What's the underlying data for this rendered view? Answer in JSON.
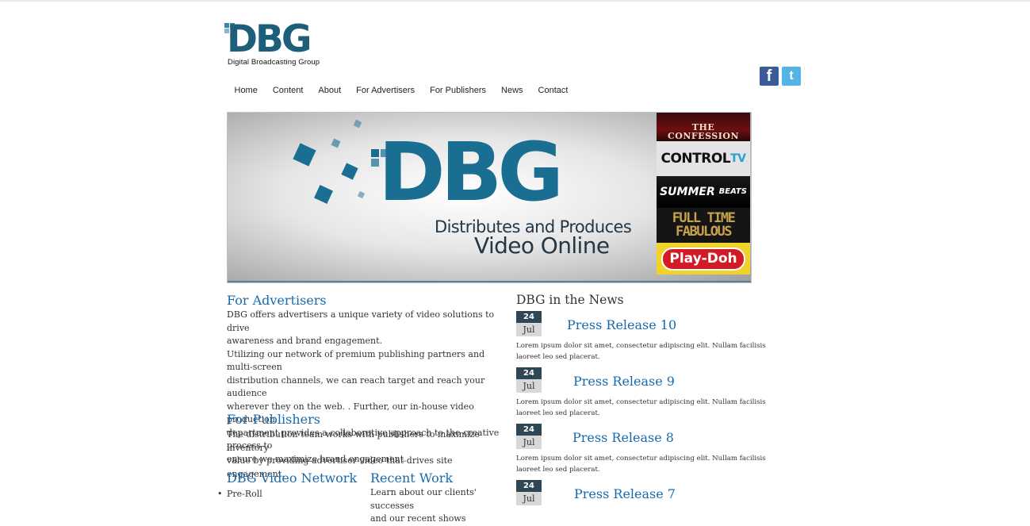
{
  "brand": {
    "logo_text": "DBG",
    "logo_subtitle": "Digital Broadcasting Group",
    "brand_color": "#1d5f7a"
  },
  "social": {
    "facebook_icon": "facebook-icon",
    "twitter_icon": "twitter-icon"
  },
  "nav": {
    "items": [
      "Home",
      "Content",
      "About",
      "For Advertisers",
      "For Publishers",
      "News",
      "Contact"
    ]
  },
  "hero": {
    "logo_text": "DBG",
    "line1": "Distributes and Produces",
    "line2": "Video Online",
    "tiles": [
      "THE CONFESSION",
      "CONTROL",
      "TV",
      "SUMMER",
      "BEATS",
      "FULL TIME\nFABULOUS",
      "Play-Doh"
    ]
  },
  "advertisers": {
    "heading": "For Advertisers",
    "lines": [
      "DBG offers advertisers a unique variety of video solutions to drive",
      "awareness and brand engagement.",
      "Utilizing our network of premium publishing partners and multi-screen",
      "distribution channels, we can reach target and reach your audience",
      "wherever they on the web. . Further, our in-house video production",
      "department provides a collaborative approach to the creative process to",
      "ensure we maximize brand engagement."
    ]
  },
  "publishers": {
    "heading": "For Publishers",
    "lines": [
      "The distribution team works with publishers to maximize inventory",
      "value by providing advertiser video that drives site engagement."
    ]
  },
  "network": {
    "heading": "DBG Video Network",
    "items": [
      "Pre-Roll"
    ]
  },
  "recent_work": {
    "heading": "Recent Work",
    "lines": [
      "Learn about our clients' successes",
      "and our recent shows"
    ]
  },
  "news": {
    "heading": "DBG in the News",
    "items": [
      {
        "day": "24",
        "month": "Jul",
        "title": "Press Release 10",
        "body": "Lorem ipsum dolor sit amet, consectetur adipiscing elit. Nullam facilisis laoreet leo sed placerat."
      },
      {
        "day": "24",
        "month": "Jul",
        "title": "Press Release 9",
        "body": "Lorem ipsum dolor sit amet, consectetur adipiscing elit. Nullam facilisis laoreet leo sed placerat."
      },
      {
        "day": "24",
        "month": "Jul",
        "title": "Press Release 8",
        "body": "Lorem ipsum dolor sit amet, consectetur adipiscing elit. Nullam facilisis laoreet leo sed placerat."
      },
      {
        "day": "24",
        "month": "Jul",
        "title": "Press Release 7",
        "body": ""
      }
    ]
  }
}
